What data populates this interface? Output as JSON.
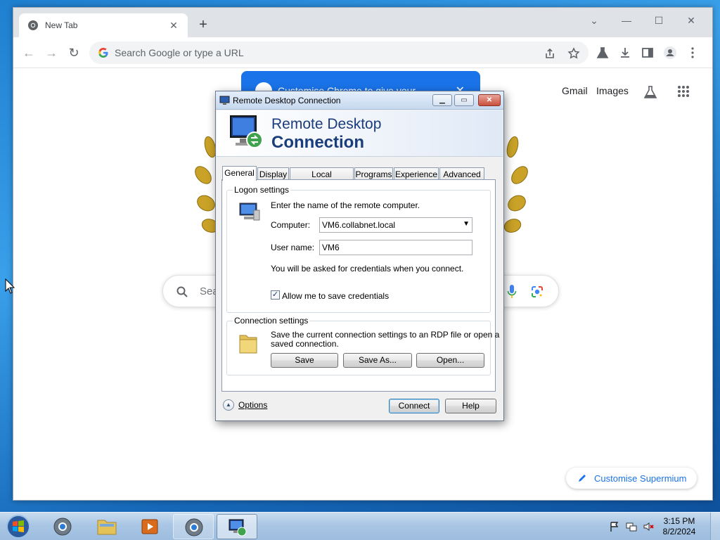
{
  "browser": {
    "tab_title": "New Tab",
    "omnibox_placeholder": "Search Google or type a URL",
    "header_links": {
      "gmail": "Gmail",
      "images": "Images"
    },
    "promo_text": "Customise Chrome to give your",
    "search_placeholder": "Sea",
    "customise_button": "Customise Supermium"
  },
  "rdp": {
    "window_title": "Remote Desktop Connection",
    "banner_line1": "Remote Desktop",
    "banner_line2": "Connection",
    "tabs": [
      "General",
      "Display",
      "Local Resources",
      "Programs",
      "Experience",
      "Advanced"
    ],
    "active_tab": "General",
    "logon": {
      "legend": "Logon settings",
      "instruction": "Enter the name of the remote computer.",
      "computer_label": "Computer:",
      "computer_value": "VM6.collabnet.local",
      "username_label": "User name:",
      "username_value": "VM6",
      "credentials_note": "You will be asked for credentials when you connect.",
      "save_credentials_label": "Allow me to save credentials",
      "save_credentials_checked": true
    },
    "connection": {
      "legend": "Connection settings",
      "description_line1": "Save the current connection settings to an RDP file or open a",
      "description_line2": "saved connection.",
      "save": "Save",
      "save_as": "Save As...",
      "open": "Open..."
    },
    "options": "Options",
    "connect": "Connect",
    "help": "Help"
  },
  "taskbar": {
    "time": "3:15 PM",
    "date": "8/2/2024",
    "apps": [
      "start-orb",
      "supermium",
      "windows-explorer",
      "media-player",
      "supermium-active",
      "remote-desktop-connection"
    ]
  },
  "colors": {
    "rdp_banner_text": "#1a3d7c",
    "chrome_blue": "#1a73e8",
    "desktop_blue": "#1f7fd0"
  }
}
